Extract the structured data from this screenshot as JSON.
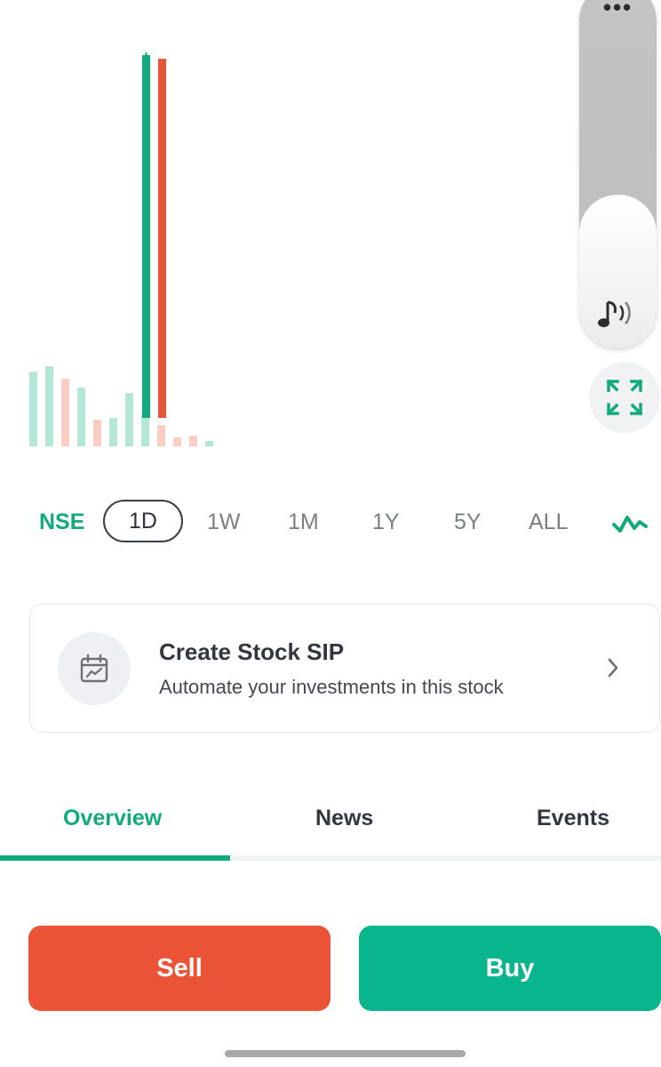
{
  "chart_data": {
    "type": "bar",
    "note_series": [
      "price_candles",
      "volume"
    ],
    "candles": [
      {
        "direction": "up",
        "color": "#13a97e",
        "high": 1.0,
        "low": 0.0
      },
      {
        "direction": "down",
        "color": "#e8563a",
        "high": 0.99,
        "low": 0.0
      }
    ],
    "volume_colors": {
      "up": "#b5e7d9",
      "down": "#f9cdc2"
    },
    "volume": [
      {
        "dir": "up",
        "value": 0.42
      },
      {
        "dir": "up",
        "value": 0.45
      },
      {
        "dir": "down",
        "value": 0.38
      },
      {
        "dir": "up",
        "value": 0.33
      },
      {
        "dir": "down",
        "value": 0.15
      },
      {
        "dir": "up",
        "value": 0.16
      },
      {
        "dir": "up",
        "value": 0.3
      },
      {
        "dir": "up",
        "value": 0.18
      },
      {
        "dir": "down",
        "value": 0.12
      },
      {
        "dir": "down",
        "value": 0.05
      },
      {
        "dir": "down",
        "value": 0.06
      },
      {
        "dir": "up",
        "value": 0.03
      }
    ]
  },
  "media_panel": {
    "icon": "music-note-sound-icon",
    "level": 0.42,
    "menu_icon": "more-icon"
  },
  "fullscreen": {
    "icon": "expand-icon"
  },
  "ranges": {
    "exchange": "NSE",
    "options": [
      "1D",
      "1W",
      "1M",
      "1Y",
      "5Y",
      "ALL"
    ],
    "selected": "1D",
    "chart_type_icon": "line-chart-icon"
  },
  "sip_card": {
    "icon": "calendar-chart-icon",
    "title": "Create Stock SIP",
    "subtitle": "Automate your investments in this stock"
  },
  "tabs": {
    "items": [
      "Overview",
      "News",
      "Events"
    ],
    "active": "Overview"
  },
  "actions": {
    "sell_label": "Sell",
    "buy_label": "Buy"
  },
  "colors": {
    "accent_green": "#13a97e",
    "sell_red": "#ea5335",
    "buy_green": "#08b58c"
  }
}
